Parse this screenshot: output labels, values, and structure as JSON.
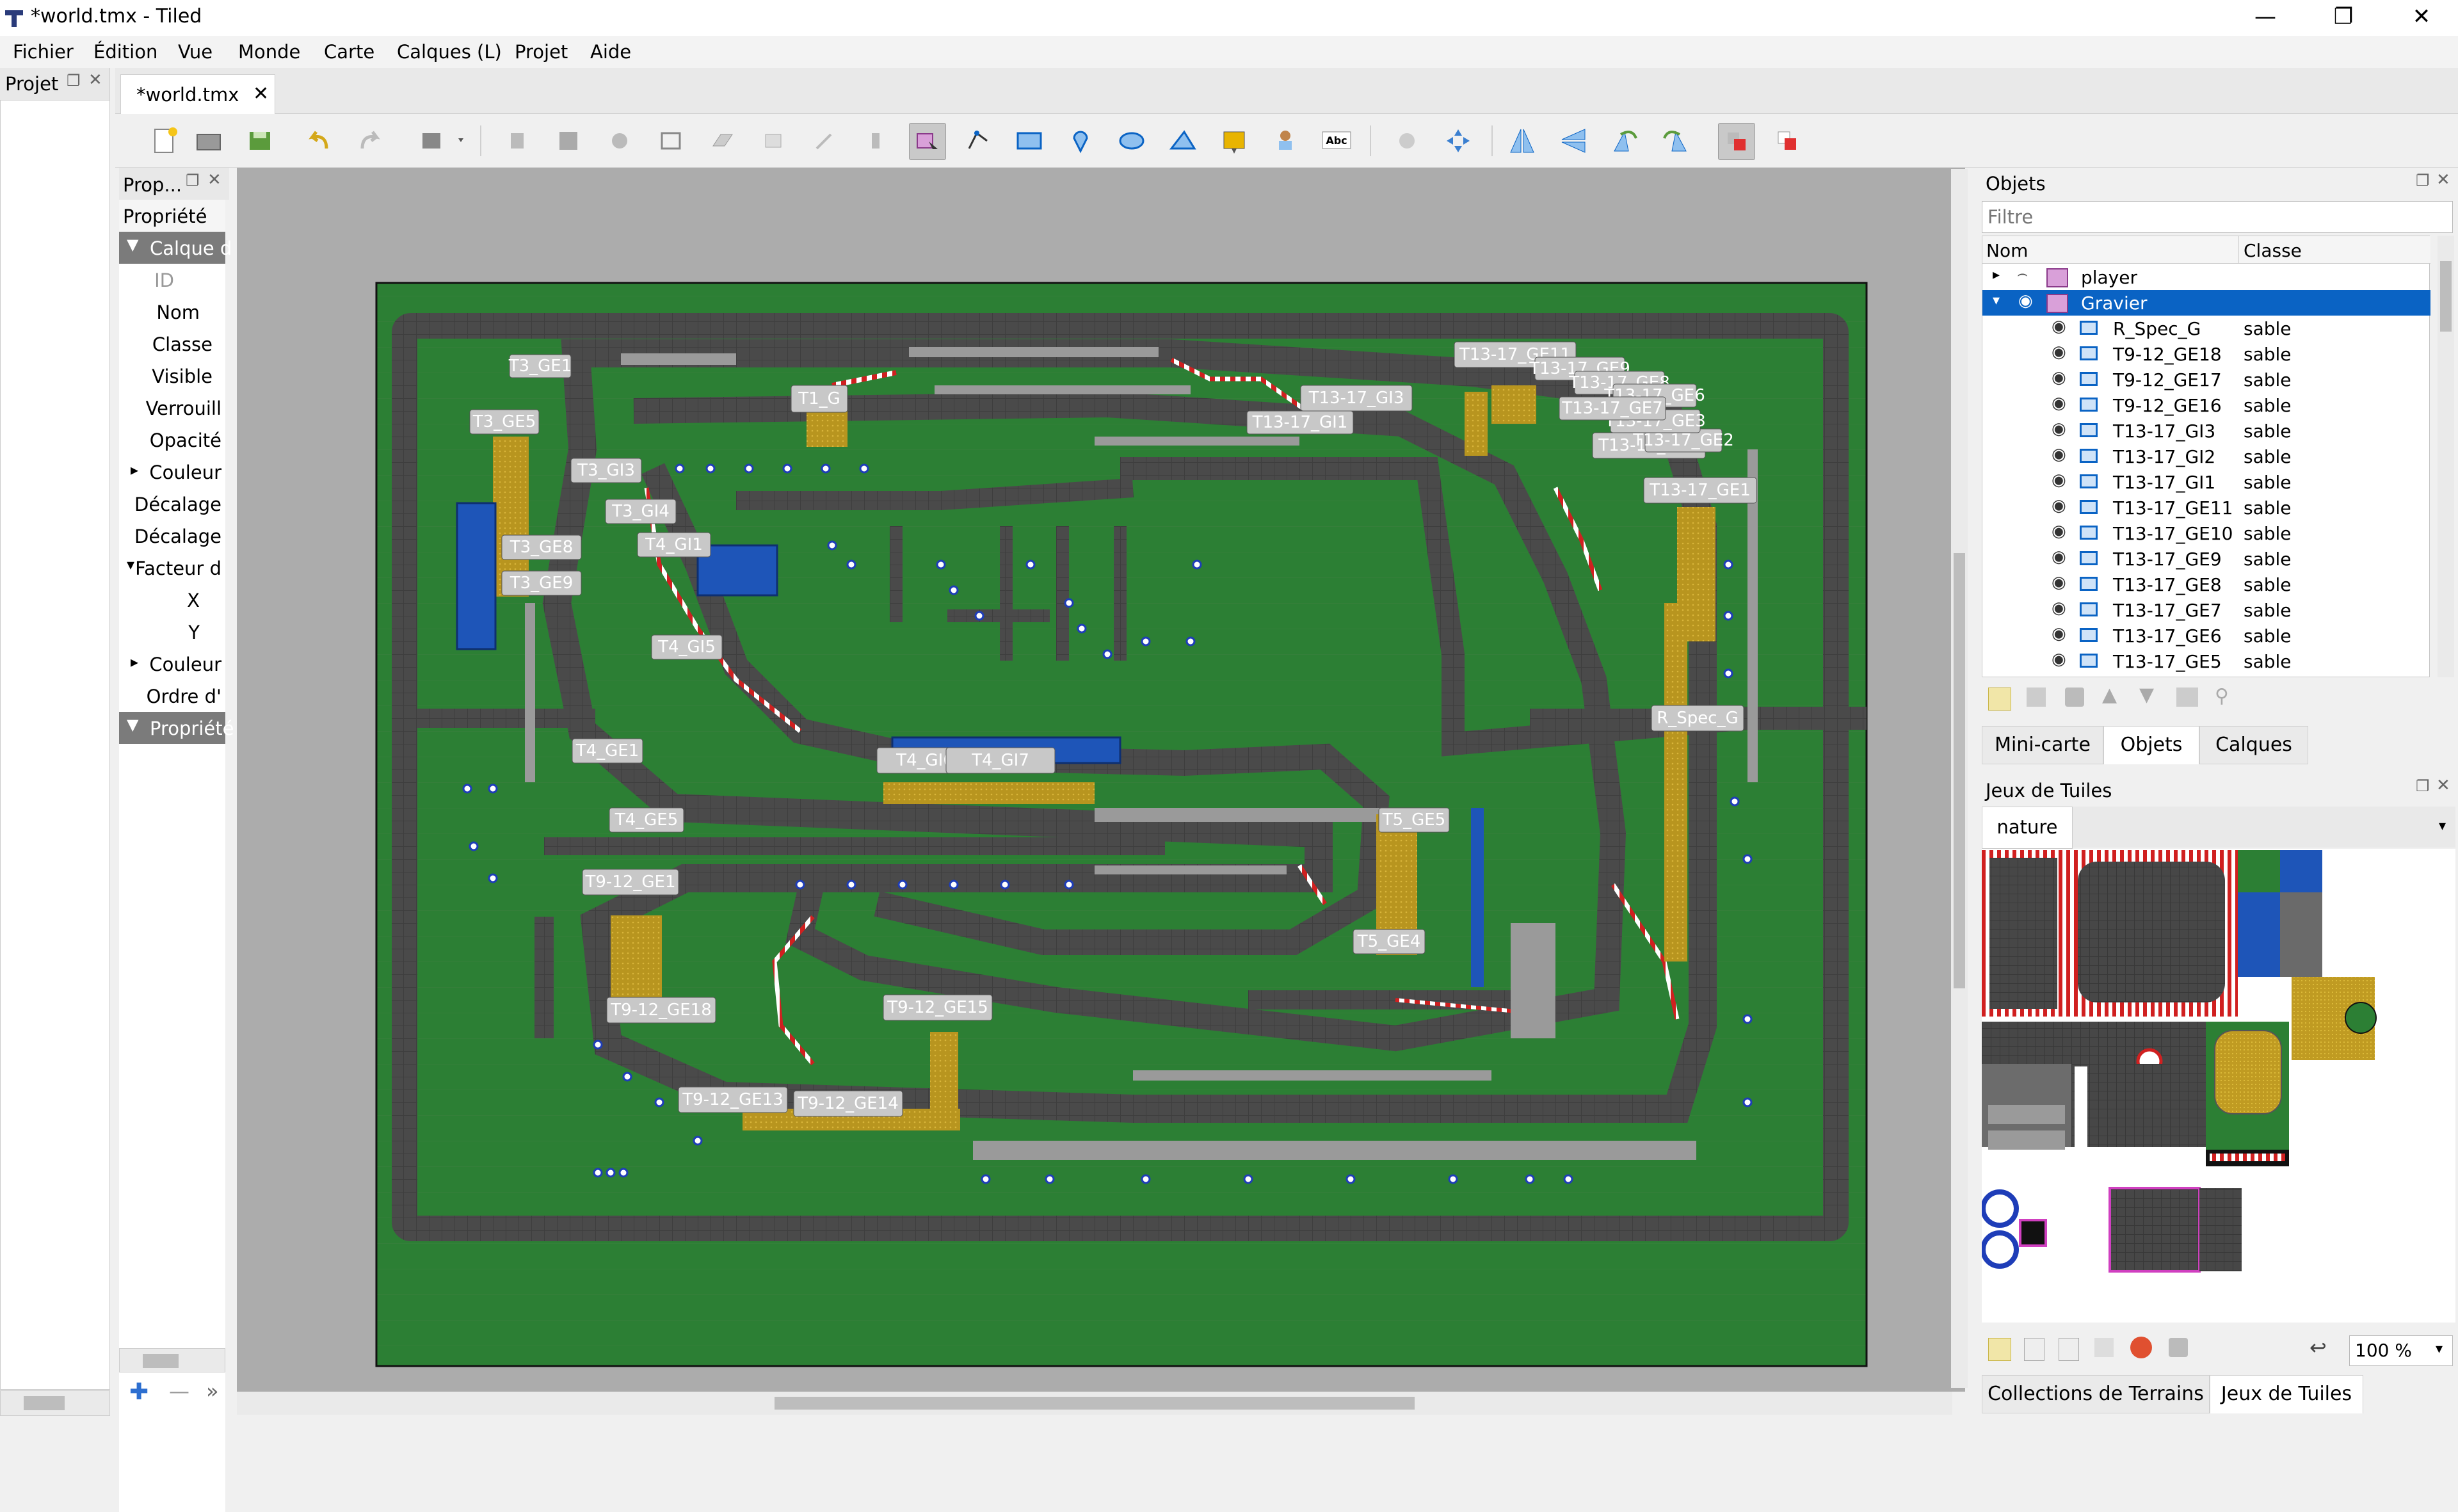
{
  "window": {
    "title": "*world.tmx - Tiled"
  },
  "menu": [
    "Fichier",
    "Édition",
    "Vue",
    "Monde",
    "Carte",
    "Calques (L)",
    "Projet",
    "Aide"
  ],
  "project_dock": {
    "title": "Projet"
  },
  "document_tab": {
    "label": "*world.tmx"
  },
  "properties": {
    "title": "Prop...",
    "header": "Propriété",
    "rows": [
      "Calque d",
      "ID",
      "Nom",
      "Classe",
      "Visible",
      "Verrouill",
      "Opacité",
      "Couleur",
      "Décalage",
      "Décalage",
      "Facteur d",
      "X",
      "Y",
      "Couleur",
      "Ordre d'",
      "Propriété"
    ]
  },
  "objects_panel": {
    "title": "Objets",
    "filter_placeholder": "Filtre",
    "col_name": "Nom",
    "col_class": "Classe",
    "layers": [
      "player",
      "Gravier"
    ],
    "items": [
      {
        "name": "R_Spec_G",
        "class": "sable"
      },
      {
        "name": "T9-12_GE18",
        "class": "sable"
      },
      {
        "name": "T9-12_GE17",
        "class": "sable"
      },
      {
        "name": "T9-12_GE16",
        "class": "sable"
      },
      {
        "name": "T13-17_GI3",
        "class": "sable"
      },
      {
        "name": "T13-17_GI2",
        "class": "sable"
      },
      {
        "name": "T13-17_GI1",
        "class": "sable"
      },
      {
        "name": "T13-17_GE11",
        "class": "sable"
      },
      {
        "name": "T13-17_GE10",
        "class": "sable"
      },
      {
        "name": "T13-17_GE9",
        "class": "sable"
      },
      {
        "name": "T13-17_GE8",
        "class": "sable"
      },
      {
        "name": "T13-17_GE7",
        "class": "sable"
      },
      {
        "name": "T13-17_GE6",
        "class": "sable"
      },
      {
        "name": "T13-17_GE5",
        "class": "sable"
      }
    ]
  },
  "right_tabs": [
    "Mini-carte",
    "Objets",
    "Calques"
  ],
  "tilesets_panel": {
    "title": "Jeux de Tuiles",
    "tab": "nature",
    "zoom": "100 %"
  },
  "bottom_tabs": [
    "Collections de Terrains",
    "Jeux de Tuiles"
  ],
  "map_labels": [
    "T3_GE1",
    "T3_GE5",
    "T3_GI3",
    "T3_GI4",
    "T3_GE8",
    "T3_GE9",
    "T1_G",
    "T4_GI1",
    "T4_GI5",
    "T4_GI6",
    "T4_GI7",
    "T4_GE1",
    "T4_GE5",
    "T9-12_GE1",
    "T9-12_GE18",
    "T9-12_GE13",
    "T9-12_GE14",
    "T9-12_GE15",
    "T5_GE5",
    "T5_GE4",
    "R_Spec_G",
    "T13-17_GE11",
    "T13-17_GI3",
    "T13-17_GE5",
    "T13-17_GE1",
    "T13-17_GE9",
    "T13-17_GE8",
    "T13-17_GE6",
    "T13-17_GE2",
    "T13-17_GE3",
    "T13-17_GE7",
    "T13-17_GI1"
  ]
}
